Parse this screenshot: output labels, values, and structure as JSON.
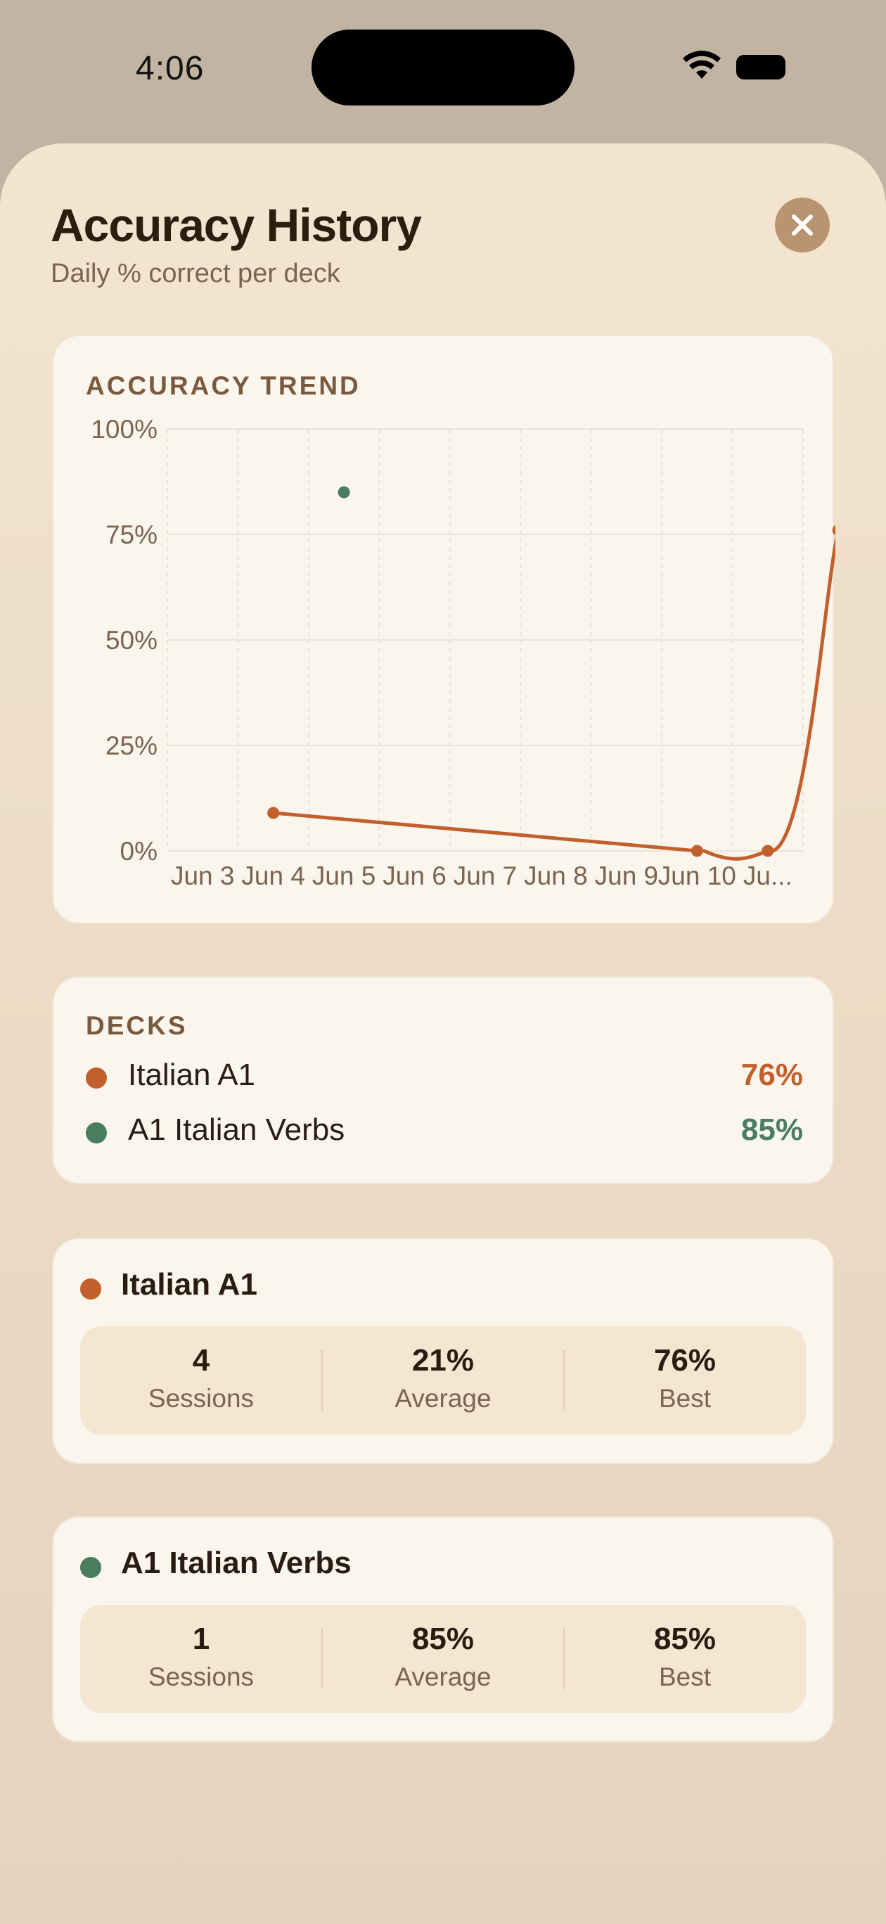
{
  "status_bar": {
    "time": "4:06"
  },
  "header": {
    "title": "Accuracy History",
    "subtitle": "Daily % correct per deck"
  },
  "trend": {
    "label": "ACCURACY TREND"
  },
  "chart_data": {
    "type": "line",
    "title": "",
    "xlabel": "",
    "ylabel": "",
    "ylim": [
      0,
      100
    ],
    "y_ticks": [
      "100%",
      "75%",
      "50%",
      "25%",
      "0%"
    ],
    "x_tick_labels": [
      "Jun 3",
      "Jun 4",
      "Jun 5",
      "Jun 6",
      "Jun 7",
      "Jun 8",
      "Jun 9",
      "Jun 10",
      "Ju..."
    ],
    "grid": true,
    "series": [
      {
        "name": "Italian A1",
        "color": "#c2602d",
        "points": [
          {
            "x": "Jun 3",
            "y": 9
          },
          {
            "x": "Jun 9",
            "y": 0
          },
          {
            "x": "Jun 10",
            "y": 0
          },
          {
            "x": "Jun 11",
            "y": 76
          }
        ]
      },
      {
        "name": "A1 Italian Verbs",
        "color": "#4a7c5e",
        "points": [
          {
            "x": "Jun 4",
            "y": 85
          }
        ]
      }
    ]
  },
  "decks_section": {
    "label": "DECKS",
    "items": [
      {
        "name": "Italian A1",
        "value": "76%",
        "color": "#c2602d"
      },
      {
        "name": "A1 Italian Verbs",
        "value": "85%",
        "color": "#4a7c5e"
      }
    ]
  },
  "deck_cards": [
    {
      "name": "Italian A1",
      "color": "#c2602d",
      "stats": [
        {
          "value": "4",
          "label": "Sessions"
        },
        {
          "value": "21%",
          "label": "Average"
        },
        {
          "value": "76%",
          "label": "Best"
        }
      ]
    },
    {
      "name": "A1 Italian Verbs",
      "color": "#4a7c5e",
      "stats": [
        {
          "value": "1",
          "label": "Sessions"
        },
        {
          "value": "85%",
          "label": "Average"
        },
        {
          "value": "85%",
          "label": "Best"
        }
      ]
    }
  ]
}
